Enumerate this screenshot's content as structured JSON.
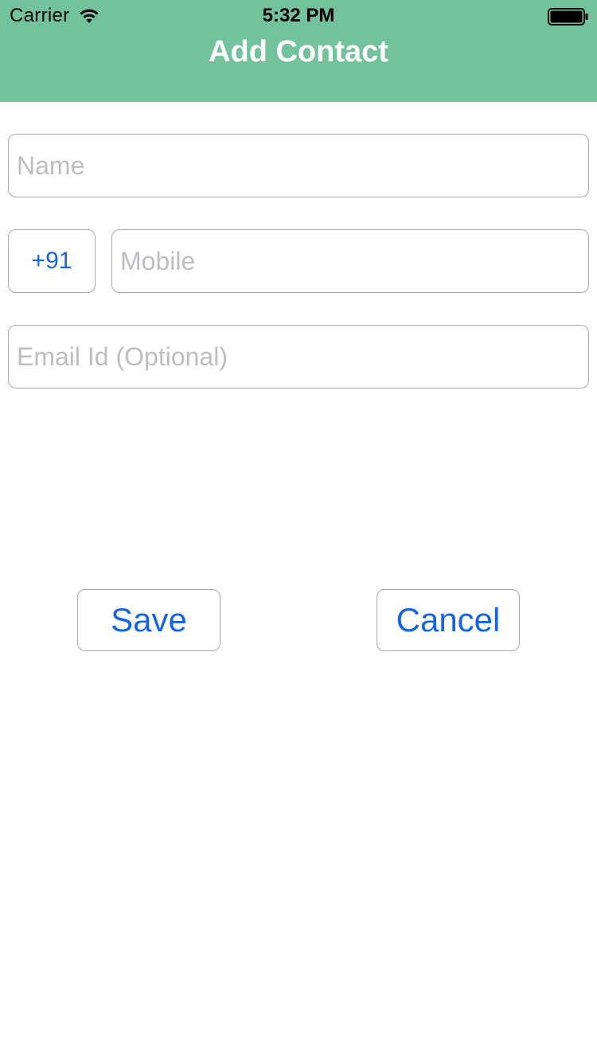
{
  "status_bar": {
    "carrier": "Carrier",
    "time": "5:32 PM",
    "wifi_icon": "wifi-icon",
    "battery_icon": "battery-icon"
  },
  "header": {
    "title": "Add Contact",
    "background_color": "#72c29b"
  },
  "form": {
    "name": {
      "placeholder": "Name",
      "value": ""
    },
    "country_code": "+91",
    "mobile": {
      "placeholder": "Mobile",
      "value": ""
    },
    "email": {
      "placeholder": "Email Id (Optional)",
      "value": ""
    }
  },
  "actions": {
    "save_label": "Save",
    "cancel_label": "Cancel",
    "accent_color": "#1565e3"
  }
}
